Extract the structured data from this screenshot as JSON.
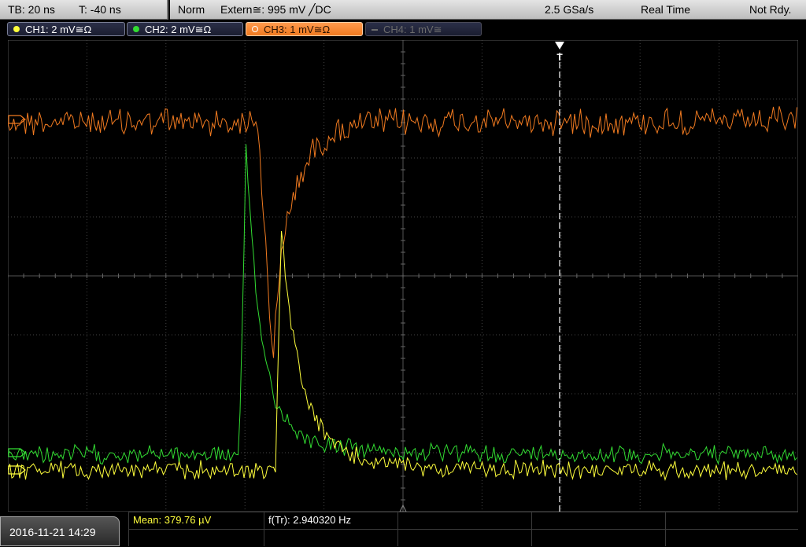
{
  "status": {
    "timebase": "TB: 20 ns",
    "trigger_offset": "T: -40 ns",
    "acq_mode": "Norm",
    "trigger": "Extern≅: 995 mV ╱DC",
    "sample_rate": "2.5 GSa/s",
    "real_time": "Real Time",
    "state": "Not Rdy."
  },
  "channels": [
    {
      "label": "CH1: 2 mV≅Ω",
      "color": "#ffff3c",
      "active": true
    },
    {
      "label": "CH2: 2 mV≅Ω",
      "color": "#32dc32",
      "active": true
    },
    {
      "label": "CH3: 1 mV≅Ω",
      "color": "#f07a20",
      "active": true
    },
    {
      "label": "CH4: 1 mV≅",
      "color": "#6c6c6c",
      "active": false
    }
  ],
  "trigger_marker": "T",
  "footer": {
    "datetime": "2016-11-21 14:29",
    "mean": "Mean: 379.76 µV",
    "freq": "f(Tr): 2.940320 Hz"
  },
  "colors": {
    "ch1": "#ffff3c",
    "ch2": "#32dc32",
    "ch3": "#f07a20",
    "grid": "#444444",
    "trigger_line": "#ffffff"
  }
}
